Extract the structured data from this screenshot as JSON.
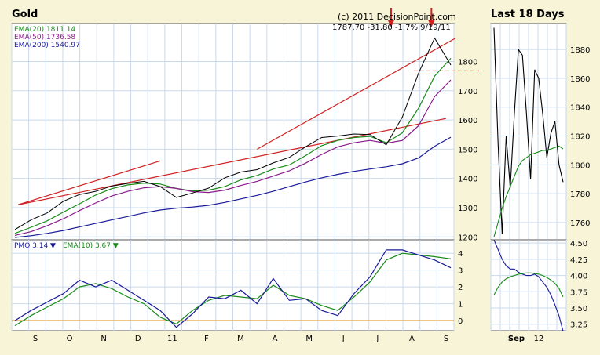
{
  "chart_data": [
    {
      "type": "line",
      "title": "Gold",
      "copyright": "(c) 2011 DecisionPoint.com",
      "quote": "1787.70  -31.80  -1.7%  9/19/11",
      "months": [
        "S",
        "O",
        "N",
        "D",
        "11",
        "F",
        "M",
        "A",
        "M",
        "J",
        "J",
        "A",
        "S"
      ],
      "ylim": [
        1190,
        1930
      ],
      "yticks": [
        1200,
        1300,
        1400,
        1500,
        1600,
        1700,
        1800
      ],
      "series": [
        {
          "name": "EMA(20) 1811.14",
          "color": "#1a8a1a",
          "values": [
            1212,
            1233,
            1255,
            1285,
            1313,
            1343,
            1365,
            1378,
            1384,
            1381,
            1366,
            1357,
            1360,
            1372,
            1395,
            1410,
            1432,
            1446,
            1478,
            1512,
            1530,
            1540,
            1544,
            1522,
            1556,
            1640,
            1750,
            1811
          ]
        },
        {
          "name": "EMA(50) 1736.58",
          "color": "#8a1a8a",
          "values": [
            1205,
            1218,
            1238,
            1262,
            1290,
            1316,
            1340,
            1356,
            1368,
            1372,
            1366,
            1355,
            1352,
            1360,
            1376,
            1390,
            1408,
            1426,
            1452,
            1482,
            1508,
            1522,
            1530,
            1520,
            1530,
            1580,
            1680,
            1737
          ]
        },
        {
          "name": "EMA(200) 1540.97",
          "color": "#1a1a9a",
          "values": [
            1198,
            1204,
            1212,
            1222,
            1234,
            1246,
            1258,
            1270,
            1282,
            1292,
            1298,
            1302,
            1308,
            1318,
            1330,
            1342,
            1356,
            1372,
            1388,
            1402,
            1414,
            1424,
            1432,
            1440,
            1450,
            1470,
            1510,
            1541
          ]
        },
        {
          "name": "Price",
          "color": "#000000",
          "values": [
            1225,
            1258,
            1282,
            1322,
            1345,
            1356,
            1374,
            1383,
            1390,
            1372,
            1335,
            1350,
            1367,
            1402,
            1422,
            1430,
            1453,
            1472,
            1508,
            1540,
            1545,
            1552,
            1550,
            1515,
            1610,
            1760,
            1880,
            1788
          ]
        }
      ],
      "trendlines": [
        {
          "color": "#d02020",
          "points": [
            [
              0.2,
              1310
            ],
            [
              26.7,
              1605
            ]
          ]
        },
        {
          "color": "#d02020",
          "points": [
            [
              0.2,
              1310
            ],
            [
              9,
              1460
            ]
          ]
        },
        {
          "color": "#d02020",
          "points": [
            [
              15,
              1500
            ],
            [
              27.3,
              1880
            ]
          ]
        }
      ],
      "support_level": 1768,
      "arrows": [
        23.3,
        25.8
      ]
    },
    {
      "type": "line",
      "title": "",
      "legend": [
        {
          "label": "PMO",
          "value": "3.14",
          "dir": "down",
          "color": "#1a1a9a"
        },
        {
          "label": "EMA(10)",
          "value": "3.67",
          "dir": "down",
          "color": "#1a8a1a"
        }
      ],
      "ylim": [
        -0.6,
        4.8
      ],
      "yticks": [
        0,
        1,
        2,
        3,
        4
      ],
      "zero_line": 0,
      "series": [
        {
          "name": "PMO",
          "color": "#1a1a9a",
          "values": [
            0.0,
            0.6,
            1.1,
            1.6,
            2.4,
            2.0,
            2.4,
            1.8,
            1.2,
            0.6,
            -0.4,
            0.4,
            1.4,
            1.3,
            1.8,
            1.0,
            2.5,
            1.2,
            1.3,
            0.6,
            0.3,
            1.6,
            2.6,
            4.2,
            4.2,
            3.9,
            3.6,
            3.14
          ]
        },
        {
          "name": "EMA(10)",
          "color": "#1a8a1a",
          "values": [
            -0.3,
            0.3,
            0.8,
            1.3,
            2.0,
            2.2,
            1.9,
            1.4,
            1.0,
            0.2,
            -0.2,
            0.6,
            1.2,
            1.5,
            1.4,
            1.3,
            2.1,
            1.5,
            1.3,
            0.9,
            0.6,
            1.4,
            2.3,
            3.6,
            4.0,
            3.9,
            3.8,
            3.67
          ]
        }
      ]
    },
    {
      "type": "line",
      "title": "Last 18 Days",
      "ylim": [
        1748,
        1898
      ],
      "yticks": [
        1760,
        1780,
        1800,
        1820,
        1840,
        1860,
        1880
      ],
      "series": [
        {
          "name": "Price",
          "color": "#000000",
          "values": [
            1895,
            1815,
            1752,
            1820,
            1784,
            1835,
            1880,
            1876,
            1835,
            1790,
            1866,
            1860,
            1835,
            1805,
            1822,
            1830,
            1800,
            1788
          ]
        },
        {
          "name": "EMA(20)",
          "color": "#1a8a1a",
          "values": [
            1750,
            1760,
            1770,
            1778,
            1785,
            1792,
            1799,
            1803,
            1805,
            1807,
            1808,
            1809,
            1810,
            1810,
            1811,
            1812,
            1813,
            1811
          ]
        }
      ]
    },
    {
      "type": "line",
      "title": "",
      "ylim": [
        3.15,
        4.55
      ],
      "yticks": [
        3.25,
        3.5,
        3.75,
        4.0,
        4.25,
        4.5
      ],
      "xlabels": [
        {
          "label": "Sep",
          "at": 5.5
        },
        {
          "label": "12",
          "at": 11
        }
      ],
      "series": [
        {
          "name": "PMO",
          "color": "#1a1a9a",
          "values": [
            4.55,
            4.4,
            4.25,
            4.15,
            4.1,
            4.1,
            4.05,
            4.02,
            4.0,
            4.0,
            4.02,
            3.98,
            3.9,
            3.82,
            3.7,
            3.55,
            3.38,
            3.14
          ]
        },
        {
          "name": "EMA(10)",
          "color": "#1a8a1a",
          "values": [
            3.7,
            3.82,
            3.9,
            3.95,
            3.98,
            4.0,
            4.02,
            4.03,
            4.04,
            4.04,
            4.03,
            4.02,
            4.0,
            3.97,
            3.93,
            3.88,
            3.8,
            3.67
          ]
        }
      ]
    }
  ]
}
